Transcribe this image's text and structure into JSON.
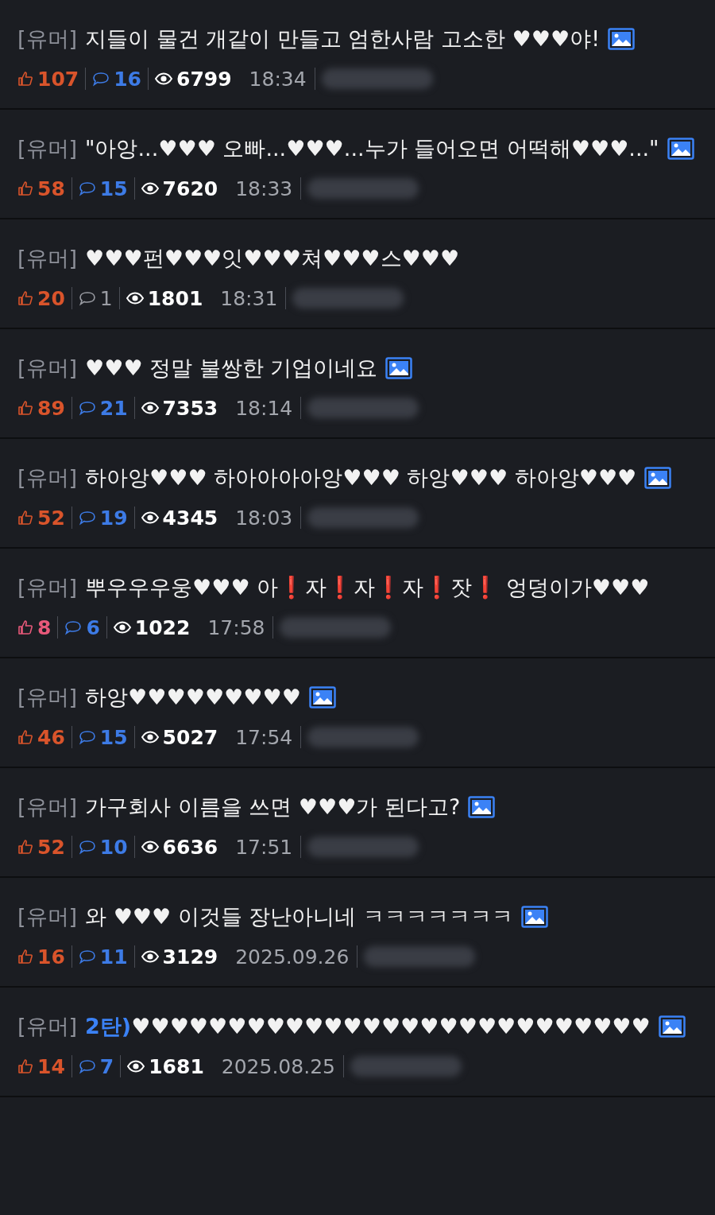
{
  "posts": [
    {
      "category": "[유머]",
      "title": "지들이 물건 개같이 만들고 엄한사람 고소한 ♥♥♥야!",
      "has_image": true,
      "likes": {
        "value": "107",
        "color": "#d9542b"
      },
      "comments": {
        "value": "16",
        "color": "#3d7be6"
      },
      "views": "6799",
      "time": "18:34"
    },
    {
      "category": "[유머]",
      "title": "\"아앙...♥♥♥ 오빠...♥♥♥...누가 들어오면 어떡해♥♥♥...\"",
      "has_image": true,
      "likes": {
        "value": "58",
        "color": "#d9542b"
      },
      "comments": {
        "value": "15",
        "color": "#3d7be6"
      },
      "views": "7620",
      "time": "18:33"
    },
    {
      "category": "[유머]",
      "title": "♥♥♥펀♥♥♥잇♥♥♥쳐♥♥♥스♥♥♥",
      "has_image": false,
      "likes": {
        "value": "20",
        "color": "#d9542b"
      },
      "comments": {
        "value": "1",
        "color": "#9a9ca3"
      },
      "views": "1801",
      "time": "18:31"
    },
    {
      "category": "[유머]",
      "title": "♥♥♥ 정말 불쌍한 기업이네요",
      "has_image": true,
      "likes": {
        "value": "89",
        "color": "#d9542b"
      },
      "comments": {
        "value": "21",
        "color": "#3d7be6"
      },
      "views": "7353",
      "time": "18:14"
    },
    {
      "category": "[유머]",
      "title": "하아앙♥♥♥ 하아아아아앙♥♥♥ 하앙♥♥♥ 하아앙♥♥♥",
      "has_image": true,
      "likes": {
        "value": "52",
        "color": "#d9542b"
      },
      "comments": {
        "value": "19",
        "color": "#3d7be6"
      },
      "views": "4345",
      "time": "18:03"
    },
    {
      "category": "[유머]",
      "title": "뿌우우우웅♥♥♥ 아❗자❗자❗자❗잣❗ 엉덩이가♥♥♥",
      "has_image": false,
      "likes": {
        "value": "8",
        "color": "#e8597a"
      },
      "comments": {
        "value": "6",
        "color": "#3d7be6"
      },
      "views": "1022",
      "time": "17:58"
    },
    {
      "category": "[유머]",
      "title": "하앙♥♥♥♥♥♥♥♥♥",
      "has_image": true,
      "likes": {
        "value": "46",
        "color": "#d9542b"
      },
      "comments": {
        "value": "15",
        "color": "#3d7be6"
      },
      "views": "5027",
      "time": "17:54"
    },
    {
      "category": "[유머]",
      "title": "가구회사 이름을 쓰면 ♥♥♥가 된다고?",
      "has_image": true,
      "likes": {
        "value": "52",
        "color": "#d9542b"
      },
      "comments": {
        "value": "10",
        "color": "#3d7be6"
      },
      "views": "6636",
      "time": "17:51"
    },
    {
      "category": "[유머]",
      "title": "와 ♥♥♥ 이것들 장난아니네 ㅋㅋㅋㅋㅋㅋㅋ",
      "has_image": true,
      "likes": {
        "value": "16",
        "color": "#d9542b"
      },
      "comments": {
        "value": "11",
        "color": "#3d7be6"
      },
      "views": "3129",
      "time": "2025.09.26"
    },
    {
      "category": "[유머]",
      "tag": "2탄)",
      "title": "♥♥♥♥♥♥♥♥♥♥♥♥♥♥♥♥♥♥♥♥♥♥♥♥♥♥♥",
      "has_image": true,
      "likes": {
        "value": "14",
        "color": "#d9542b"
      },
      "comments": {
        "value": "7",
        "color": "#3d7be6"
      },
      "views": "1681",
      "time": "2025.08.25"
    }
  ]
}
